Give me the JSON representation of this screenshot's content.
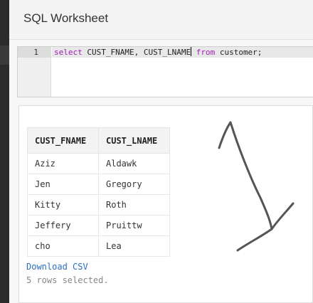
{
  "worksheet": {
    "title": "SQL Worksheet"
  },
  "editor": {
    "line_number": "1",
    "code": {
      "kw_select": "select",
      "columns": " CUST_FNAME, CUST_LNAME",
      "kw_from": " from",
      "rest": " customer;"
    }
  },
  "results": {
    "columns": [
      "CUST_FNAME",
      "CUST_LNAME"
    ],
    "rows": [
      [
        "Aziz",
        "Aldawk"
      ],
      [
        "Jen",
        "Gregory"
      ],
      [
        "Kitty",
        "Roth"
      ],
      [
        "Jeffery",
        "Pruittw"
      ],
      [
        "cho",
        "Lea"
      ]
    ],
    "download_label": "Download CSV",
    "status": "5 rows selected."
  },
  "colors": {
    "keyword": "#a020b0",
    "link": "#2a6ebd",
    "annotation": "#555555"
  }
}
